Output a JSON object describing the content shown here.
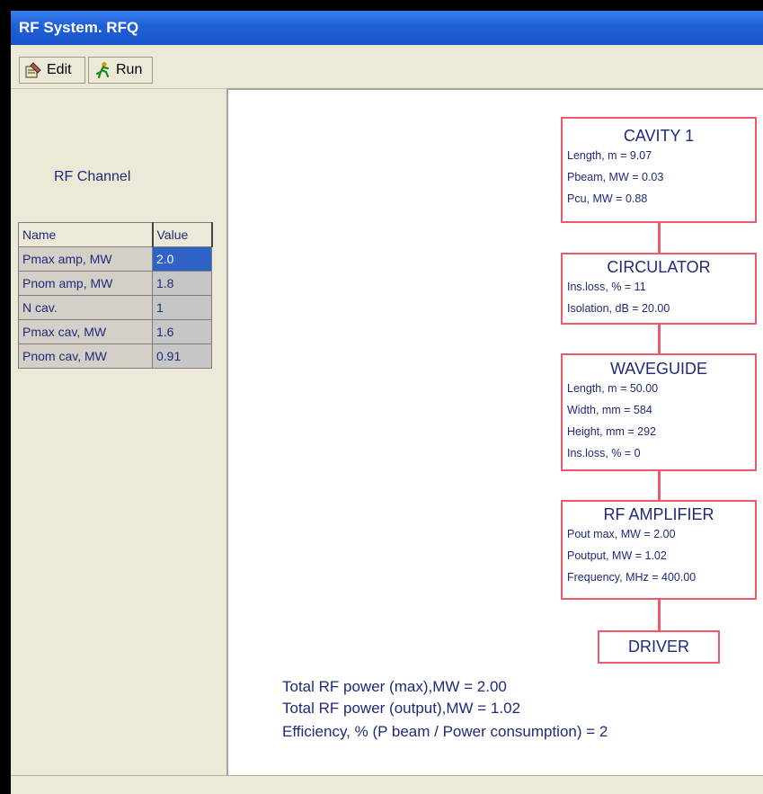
{
  "window": {
    "title": "RF System. RFQ"
  },
  "toolbar": {
    "edit_label": "Edit",
    "run_label": "Run"
  },
  "left": {
    "heading": "RF Channel",
    "table": {
      "headers": [
        "Name",
        "Value"
      ],
      "rows": [
        {
          "name": "Pmax amp, MW",
          "value": "2.0"
        },
        {
          "name": "Pnom amp, MW",
          "value": "1.8"
        },
        {
          "name": "N cav.",
          "value": "1"
        },
        {
          "name": "Pmax cav, MW",
          "value": "1.6"
        },
        {
          "name": "Pnom cav, MW",
          "value": "0.91"
        }
      ]
    }
  },
  "diagram": {
    "cavity": {
      "title": "CAVITY  1",
      "rows": [
        "Length, m   = 9.07",
        "Pbeam, MW =   0.03",
        "Pcu, MW    =   0.88"
      ]
    },
    "circulator": {
      "title": "CIRCULATOR",
      "rows": [
        "Ins.loss, %   =  11",
        "Isolation, dB =   20.00"
      ]
    },
    "waveguide": {
      "title": "WAVEGUIDE",
      "rows": [
        "Length, m    =   50.00",
        "Width, mm   =   584",
        "Height, mm  =   292",
        "Ins.loss, % =   0"
      ]
    },
    "amplifier": {
      "title": "RF AMPLIFIER",
      "rows": [
        "Pout max, MW  =  2.00",
        "Poutput, MW    =  1.02",
        "Frequency, MHz =  400.00"
      ]
    },
    "driver": {
      "title": "DRIVER"
    }
  },
  "totals": {
    "line1": "Total RF power (max),MW =     2.00",
    "line2": "Total RF power (output),MW =     1.02",
    "line3": "Efficiency, % (P beam / Power consumption) =   2"
  },
  "colors": {
    "accent": "#ef5a6a",
    "text": "#1f2a7a",
    "selection": "#2f62c6"
  }
}
